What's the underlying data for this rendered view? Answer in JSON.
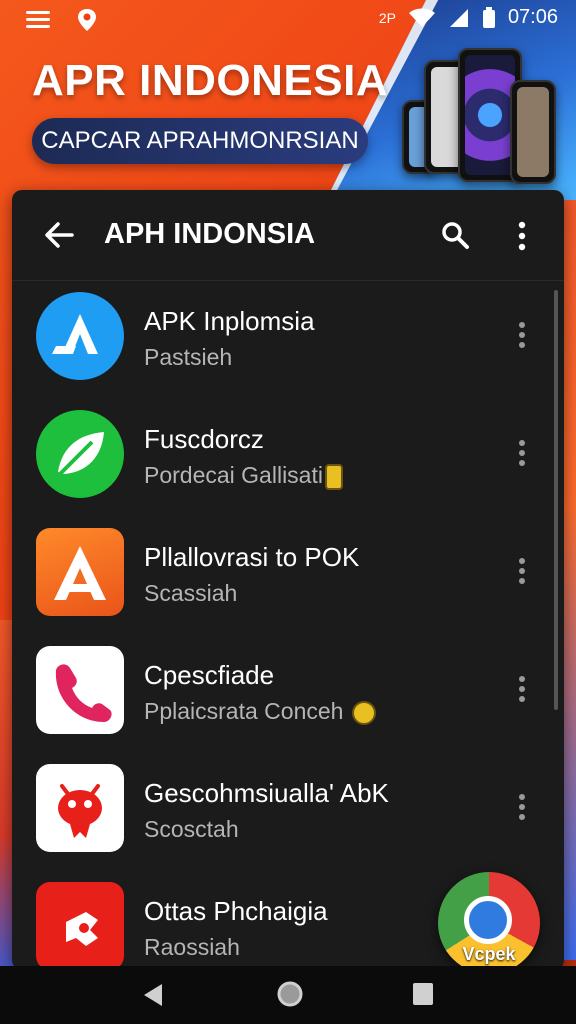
{
  "status_bar": {
    "time": "07:06",
    "extra": "2P"
  },
  "hero": {
    "title": "APR INDONESIA",
    "subtitle": "CAPCAR APRAHMONRSIAN"
  },
  "app_bar": {
    "title": "APH INDONSIA"
  },
  "apps": [
    {
      "name": "APK Inplomsia",
      "subtitle": "Pastsieh",
      "icon": "apk-letter-a-icon",
      "color": "#1e9df2"
    },
    {
      "name": "Fuscdorcz",
      "subtitle": "Pordecai Gallisati",
      "icon": "leaf-icon",
      "color": "#1fbf3e"
    },
    {
      "name": "Pllallovrasi to POK",
      "subtitle": "Scassiah",
      "icon": "letter-a-icon",
      "color": "#f26a1b"
    },
    {
      "name": "Cpescfiade",
      "subtitle": "Pplaicsrata Conceh",
      "icon": "phone-icon",
      "color": "#ffffff"
    },
    {
      "name": "Gescohmsiualla' AbK",
      "subtitle": "Scosctah",
      "icon": "robot-icon",
      "color": "#ffffff"
    },
    {
      "name": "Ottas Phchaigia",
      "subtitle": "Raossiah",
      "icon": "hand-icon",
      "color": "#e8201a"
    }
  ],
  "fab": {
    "label": "Vcpek"
  },
  "colors": {
    "background": "#ee3f14",
    "card": "#1b1b1b",
    "accent_blue": "#2b6fd6"
  }
}
